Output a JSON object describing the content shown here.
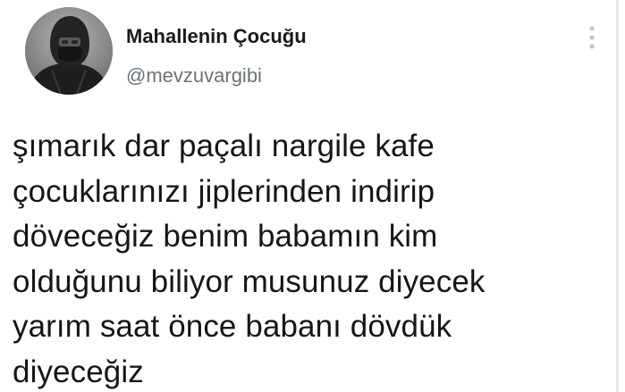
{
  "tweet": {
    "author": {
      "display_name": "Mahallenin Çocuğu",
      "handle": "@mevzuvargibi",
      "avatar_icon": "profile-photo-masked-person"
    },
    "more_icon": "vertical-ellipsis-icon",
    "text": "şımarık dar paçalı nargile kafe\nçocuklarınızı jiplerinden indirip\ndöveceğiz benim babamın kim\nolduğunu biliyor musunuz diyecek\nyarım saat önce babanı dövdük\ndiyeceğiz"
  },
  "colors": {
    "background": "#ffffff",
    "name_text": "#1a1a1a",
    "handle_text": "#6b737a",
    "body_text": "#161616",
    "more_icon": "#c3c6c9"
  }
}
